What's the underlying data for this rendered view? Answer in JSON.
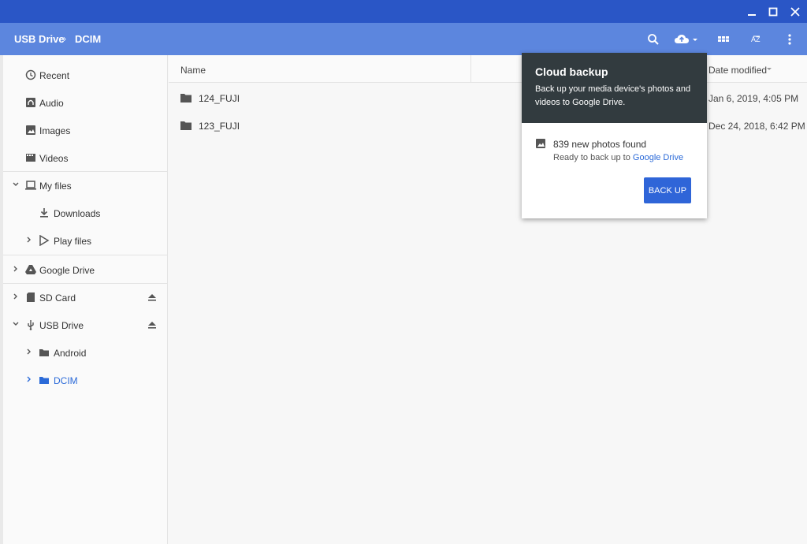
{
  "breadcrumb": {
    "parent": "USB Drive",
    "current": "DCIM",
    "separator": "›"
  },
  "sidebar": {
    "recent": "Recent",
    "audio": "Audio",
    "images": "Images",
    "videos": "Videos",
    "my_files": "My files",
    "downloads": "Downloads",
    "play_files": "Play files",
    "google_drive": "Google Drive",
    "sd_card": "SD Card",
    "usb_drive": "USB Drive",
    "android": "Android",
    "dcim": "DCIM"
  },
  "columns": {
    "name": "Name",
    "date": "Date modified"
  },
  "files": [
    {
      "name": "124_FUJI",
      "date": "Jan 6, 2019, 4:05 PM"
    },
    {
      "name": "123_FUJI",
      "date": "Dec 24, 2018, 6:42 PM"
    }
  ],
  "popup": {
    "title": "Cloud backup",
    "description": "Back up your media device's photos and videos to Google Drive.",
    "found": "839 new photos found",
    "ready_prefix": "Ready to back up to ",
    "ready_link": "Google Drive",
    "button": "BACK UP"
  },
  "colors": {
    "titlebar": "#2a56c6",
    "toolbar": "#5c86de",
    "accent": "#2f65d8",
    "popup_header": "#323b3f",
    "selected": "#2b6ad8"
  }
}
